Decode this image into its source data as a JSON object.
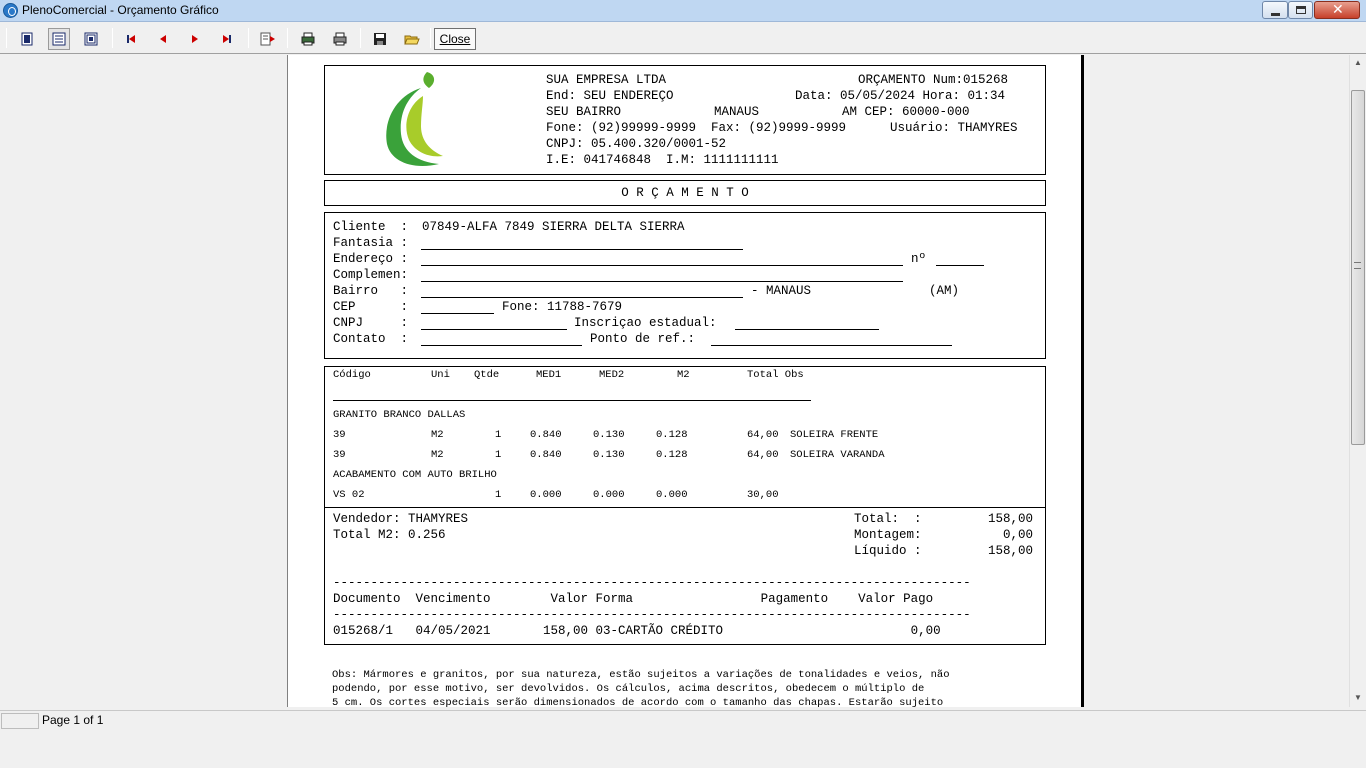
{
  "window": {
    "title": "PlenoComercial - Orçamento Gráfico",
    "close_label": "Close"
  },
  "toolbar": {
    "buttons": [
      "whole-page-icon",
      "page-width-icon",
      "zoom-100-icon",
      "first-page-icon",
      "prev-page-icon",
      "next-page-icon",
      "last-page-icon",
      "goto-page-icon",
      "printer-setup-icon",
      "print-icon",
      "save-icon",
      "open-icon"
    ]
  },
  "header": {
    "company": "SUA EMPRESA LTDA",
    "quote_num": "ORÇAMENTO Num:015268",
    "address": "End: SEU ENDEREÇO",
    "date_time": "Data: 05/05/2024 Hora: 01:34",
    "bairro": "SEU BAIRRO",
    "city": "MANAUS",
    "state_cep": "AM CEP: 60000-000",
    "phones": "Fone: (92)99999-9999  Fax: (92)9999-9999",
    "user": "Usuário: THAMYRES",
    "cnpj": "CNPJ: 05.400.320/0001-52",
    "ie_im": "I.E: 041746848  I.M: 1111111111"
  },
  "doc_title": "O R Ç A M E N T O",
  "client": {
    "cliente_label": "Cliente  :",
    "cliente_value": "07849-ALFA 7849 SIERRA DELTA SIERRA",
    "fantasia_label": "Fantasia :",
    "endereco_label": "Endereço :",
    "numero_label": "nº",
    "complemento_label": "Complemen:",
    "bairro_label": "Bairro   :",
    "city_suffix": "- MANAUS",
    "state": "(AM)",
    "cep_label": "CEP      :",
    "fone": "Fone: 11788-7679",
    "cnpj_label": "CNPJ     :",
    "ie_label": "Inscriçao estadual:",
    "contato_label": "Contato  :",
    "ref_label": "Ponto de ref.:"
  },
  "items": {
    "columns": {
      "codigo": "Código",
      "uni": "Uni",
      "qtde": "Qtde",
      "med1": "MED1",
      "med2": "MED2",
      "m2": "M2",
      "total_obs": "Total Obs"
    },
    "groups": [
      {
        "name": "GRANITO BRANCO DALLAS",
        "rows": [
          {
            "codigo": "39",
            "uni": "M2",
            "qtde": "1",
            "med1": "0.840",
            "med2": "0.130",
            "m2": "0.128",
            "total": "64,00",
            "obs": "SOLEIRA FRENTE"
          },
          {
            "codigo": "39",
            "uni": "M2",
            "qtde": "1",
            "med1": "0.840",
            "med2": "0.130",
            "m2": "0.128",
            "total": "64,00",
            "obs": "SOLEIRA VARANDA"
          }
        ]
      },
      {
        "name": "ACABAMENTO COM AUTO BRILHO",
        "rows": [
          {
            "codigo": "VS 02",
            "uni": "",
            "qtde": "1",
            "med1": "0.000",
            "med2": "0.000",
            "m2": "0.000",
            "total": "30,00",
            "obs": ""
          }
        ]
      }
    ]
  },
  "totals": {
    "vendedor": "Vendedor: THAMYRES",
    "total_m2": "Total M2: 0.256",
    "total_label": "Total:  :",
    "total_value": "158,00",
    "montagem_label": "Montagem:",
    "montagem_value": "0,00",
    "liquido_label": "Líquido :",
    "liquido_value": "158,00",
    "dashes": "---------------------------------------------------------------------------------------",
    "pay_header": "Documento  Vencimento        Valor Forma                 Pagamento    Valor Pago",
    "pay_row": "015268/1   04/05/2021       158,00 03-CARTÃO CRÉDITO                         0,00"
  },
  "obs": {
    "line1": "Obs: Mármores e granitos, por sua natureza, estão sujeitos a variações de tonalidades e veios, não",
    "line2": "podendo, por esse motivo, ser devolvidos. Os cálculos, acima descritos, obedecem o múltiplo de",
    "line3": "5 cm. Os cortes especiais serão dimensionados de acordo com o tamanho das chapas. Estarão sujeito"
  },
  "status": {
    "page_info": "Page 1 of 1"
  },
  "colors": {
    "logo_green_dark": "#3aa23a",
    "logo_green_light": "#a8cc2a",
    "titlebar": "#bfd7f2"
  }
}
